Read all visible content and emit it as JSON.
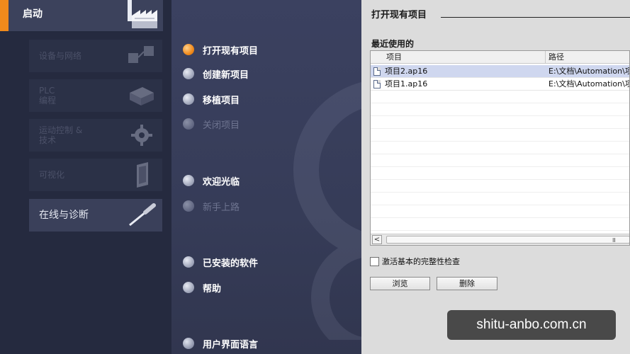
{
  "left": {
    "start": {
      "label": "启动"
    },
    "tiles": [
      {
        "label": "设备与网络",
        "state": "disabled",
        "icon": "network-icon"
      },
      {
        "label": "PLC\n编程",
        "state": "disabled",
        "icon": "plc-icon"
      },
      {
        "label": "运动控制 &\n技术",
        "state": "disabled",
        "icon": "gear-icon"
      },
      {
        "label": "可视化",
        "state": "disabled",
        "icon": "hmi-panel-icon"
      },
      {
        "label": "在线与诊断",
        "state": "active",
        "icon": "screwdriver-icon"
      }
    ]
  },
  "menu": {
    "items": [
      {
        "label": "打开现有项目",
        "state": "selected"
      },
      {
        "label": "创建新项目",
        "state": "enabled"
      },
      {
        "label": "移植项目",
        "state": "enabled"
      },
      {
        "label": "关闭项目",
        "state": "disabled"
      },
      {
        "label": "欢迎光临",
        "state": "enabled"
      },
      {
        "label": "新手上路",
        "state": "disabled"
      },
      {
        "label": "已安装的软件",
        "state": "enabled"
      },
      {
        "label": "帮助",
        "state": "enabled"
      },
      {
        "label": "用户界面语言",
        "state": "enabled"
      }
    ]
  },
  "panel": {
    "title": "打开现有项目",
    "recent_label": "最近使用的",
    "table": {
      "headers": [
        "项目",
        "路径"
      ],
      "rows": [
        {
          "project": "项目2.ap16",
          "path": "E:\\文档\\Automation\\项"
        },
        {
          "project": "项目1.ap16",
          "path": "E:\\文档\\Automation\\项"
        }
      ]
    },
    "scroll_left": "<",
    "scroll_grip": "III",
    "checkbox_label": "激活基本的完整性检查",
    "browse_label": "浏览",
    "delete_label": "删除"
  },
  "watermark": "shitu-anbo.com.cn",
  "colors": {
    "accent": "#f08a1c",
    "selected_row": "#cfd7ef"
  }
}
